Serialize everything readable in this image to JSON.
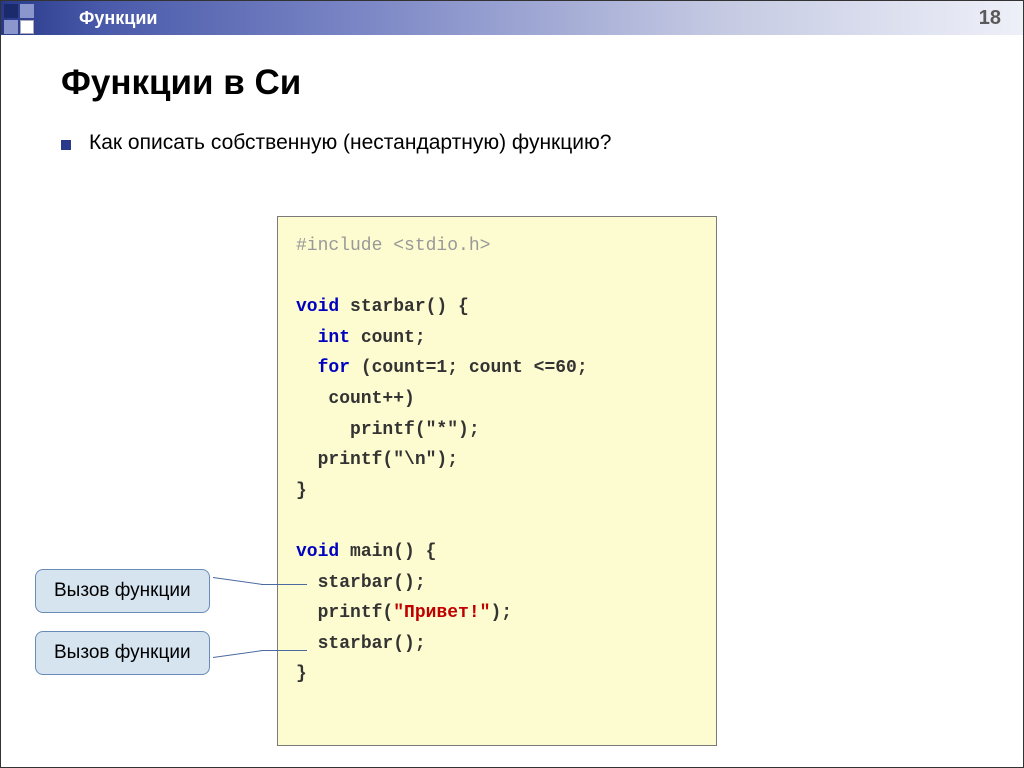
{
  "header": {
    "section": "Функции",
    "page_number": "18"
  },
  "title": "Функции в Си",
  "bullet": "Как описать собственную (нестандартную) функцию?",
  "code": {
    "l1a": "#include ",
    "l1b": "<stdio.h>",
    "l2a": "void",
    "l2b": " starbar() {",
    "l3a": "int",
    "l3b": " count;",
    "l4a": "for",
    "l4b": " (count=1; count <=60;",
    "l4c": "count++)",
    "l5": "printf(\"*\");",
    "l6": "printf(\"\\n\");",
    "l7": "}",
    "l8a": "void",
    "l8b": " main() {",
    "l9": "starbar();",
    "l10a": "printf(",
    "l10b": "\"Привет!\"",
    "l10c": ");",
    "l11": "starbar();",
    "l12": "}"
  },
  "callouts": {
    "c1": "Вызов функции",
    "c2": "Вызов функции"
  }
}
